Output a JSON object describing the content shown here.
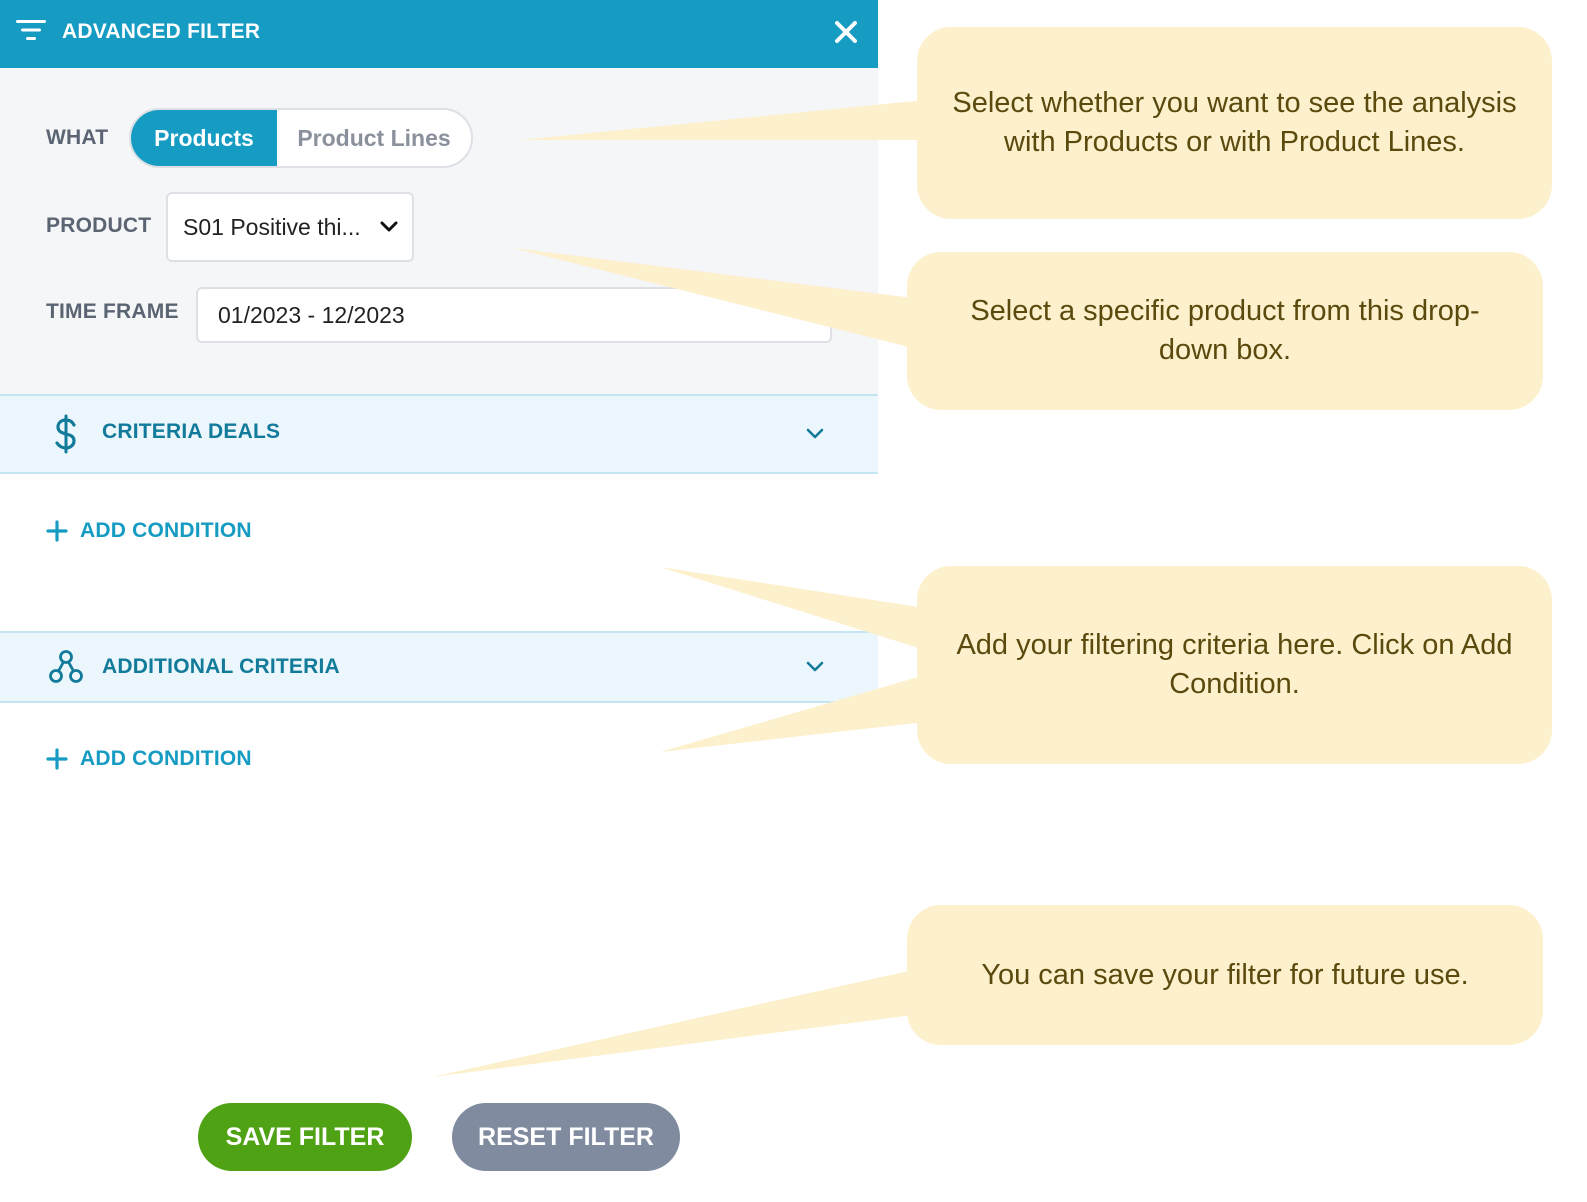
{
  "header": {
    "title": "ADVANCED FILTER",
    "icon": "filter-lines-icon",
    "close_icon": "close-icon",
    "bg_color": "#169bc2"
  },
  "form": {
    "what_label": "WHAT",
    "what_options": [
      "Products",
      "Product Lines"
    ],
    "what_selected": "Products",
    "product_label": "PRODUCT",
    "product_value": "S01 Positive thi...",
    "timeframe_label": "TIME FRAME",
    "timeframe_value": "01/2023 - 12/2023"
  },
  "sections": {
    "criteria_deals": {
      "title": "CRITERIA DEALS",
      "icon": "dollar-icon",
      "add_condition": "ADD CONDITION"
    },
    "additional_criteria": {
      "title": "ADDITIONAL CRITERIA",
      "icon": "network-icon",
      "add_condition": "ADD CONDITION"
    }
  },
  "buttons": {
    "save": "SAVE FILTER",
    "reset": "RESET FILTER",
    "save_color": "#4fa214",
    "reset_color": "#808ba0"
  },
  "callouts": [
    "Select whether you want to see the analysis with Products or with Product Lines.",
    "Select a specific product from this drop-down box.",
    "Add your filtering criteria here. Click on Add Condition.",
    "You can save your filter for future use."
  ]
}
